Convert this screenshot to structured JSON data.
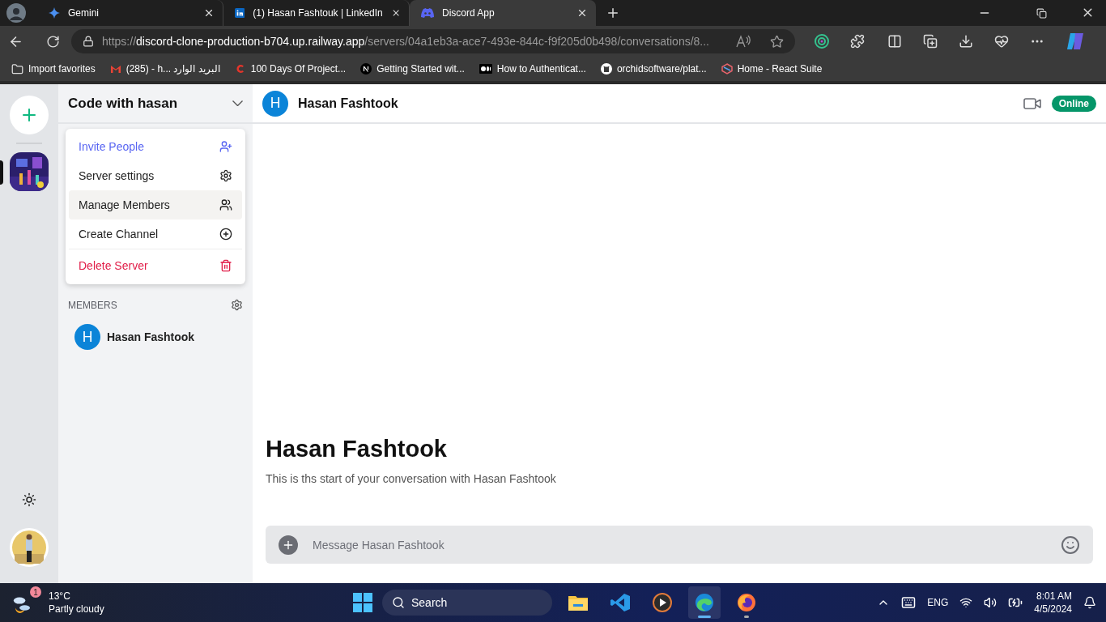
{
  "browser": {
    "tabs": [
      {
        "kind": "gemini",
        "title": "Gemini",
        "selected": false
      },
      {
        "kind": "linkedin",
        "title": "(1) Hasan Fashtouk | LinkedIn",
        "selected": false
      },
      {
        "kind": "discord",
        "title": "Discord App",
        "selected": true
      }
    ],
    "url": {
      "scheme": "https://",
      "host": "discord-clone-production-b704.up.railway.app",
      "path": "/servers/04a1eb3a-ace7-493e-844c-f9f205d0b498/conversations/8..."
    },
    "bookmarks": [
      {
        "kind": "folder",
        "label": "Import favorites"
      },
      {
        "kind": "gmail",
        "label": "(285) - h... البريد الوارد"
      },
      {
        "kind": "c",
        "label": "100 Days Of Project..."
      },
      {
        "kind": "n",
        "label": "Getting Started wit..."
      },
      {
        "kind": "medium",
        "label": "How to Authenticat..."
      },
      {
        "kind": "github",
        "label": "orchidsoftware/plat..."
      },
      {
        "kind": "rsuite",
        "label": "Home - React Suite"
      }
    ]
  },
  "server_rail": {
    "servers": [
      {
        "kind": "picture",
        "selected": true
      }
    ]
  },
  "sidebar": {
    "server_name": "Code with hasan",
    "menu": [
      {
        "kind": "invite",
        "label": "Invite People",
        "selected": false
      },
      {
        "kind": "settings",
        "label": "Server settings",
        "selected": false
      },
      {
        "kind": "members",
        "label": "Manage Members",
        "selected": true
      },
      {
        "kind": "create",
        "label": "Create Channel",
        "selected": false
      },
      {
        "kind": "delete",
        "label": "Delete Server",
        "selected": false
      }
    ],
    "members_label": "MEMBERS",
    "members": [
      {
        "initial": "H",
        "name": "Hasan Fashtook"
      }
    ]
  },
  "chat": {
    "initial": "H",
    "name": "Hasan Fashtook",
    "status": "Online",
    "intro_title": "Hasan Fashtook",
    "intro_text": "This is ths start of your conversation with Hasan Fashtook",
    "message_placeholder": "Message Hasan Fashtook"
  },
  "taskbar": {
    "weather": {
      "badge": "1",
      "temperature": "13°C",
      "condition": "Partly cloudy"
    },
    "search": {
      "placeholder": "Search"
    },
    "apps": [
      {
        "kind": "files",
        "selected": false
      },
      {
        "kind": "vscode",
        "selected": false
      },
      {
        "kind": "player",
        "selected": false
      },
      {
        "kind": "edge",
        "selected": true
      },
      {
        "kind": "firefox",
        "selected": false
      }
    ],
    "language": "ENG",
    "time": "8:01 AM",
    "date": "4/5/2024"
  }
}
